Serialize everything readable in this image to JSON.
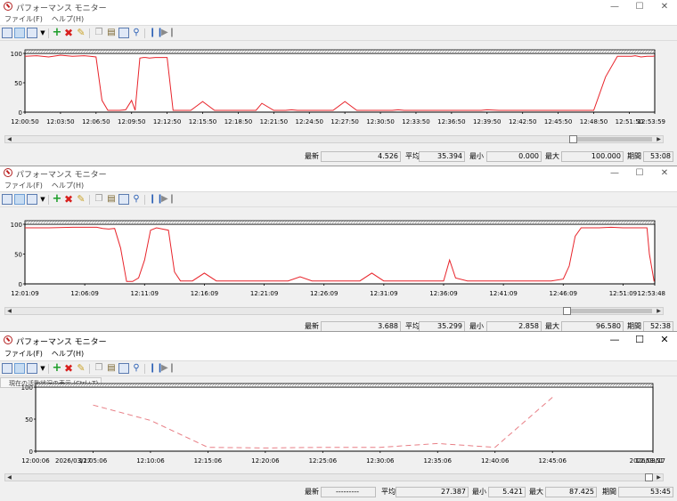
{
  "windows": [
    {
      "title": "パフォーマンス モニター",
      "menu": [
        "ファイル(F)",
        "ヘルプ(H)"
      ],
      "tooltip": "",
      "x_ticks": [
        "12:00:50",
        "12:03:50",
        "12:06:50",
        "12:09:50",
        "12:12:50",
        "12:15:50",
        "12:18:50",
        "12:21:50",
        "12:24:50",
        "12:27:50",
        "12:30:50",
        "12:33:50",
        "12:36:50",
        "12:39:50",
        "12:42:50",
        "12:45:50",
        "12:48:50",
        "12:51:50",
        "12:53:59"
      ],
      "y_ticks": [
        "100",
        "50",
        "0"
      ],
      "stats": {
        "last_label": "最新",
        "last": "4.526",
        "avg_label": "平均",
        "avg": "35.394",
        "min_label": "最小",
        "min": "0.000",
        "max_label": "最大",
        "max": "100.000",
        "dur_label": "期間",
        "dur": "53:08"
      },
      "series_color": "#e8242b",
      "line_style": "solid",
      "scroll_thumb_fraction": 0.88,
      "chart_data": {
        "type": "line",
        "x_start": "12:00:50",
        "x_end": "12:53:59",
        "ylim": [
          0,
          100
        ],
        "x_minutes": [
          0,
          1,
          2,
          3,
          4,
          5,
          5.5,
          6,
          6.5,
          7,
          8,
          8.5,
          9,
          9.3,
          9.7,
          10,
          10.2,
          10.5,
          11,
          12,
          12.5,
          13,
          14,
          15,
          16,
          17,
          18,
          18.5,
          19,
          19.5,
          20,
          21,
          22,
          22.5,
          23,
          23.5,
          24,
          25,
          26,
          27,
          28,
          29,
          30,
          31,
          31.5,
          32,
          32.5,
          33,
          33.3,
          33.7,
          34,
          34.5,
          35,
          36,
          37,
          38,
          38.5,
          39,
          40,
          41,
          42,
          42.5,
          43,
          43.5,
          44,
          45,
          46,
          47,
          48,
          49,
          50,
          51,
          51.2,
          51.5,
          52,
          52.5,
          53,
          53.15
        ],
        "values": [
          95,
          96,
          94,
          97,
          95,
          96,
          95,
          94,
          20,
          3,
          3,
          4,
          20,
          3,
          92,
          93,
          93,
          92,
          93,
          93,
          3,
          3,
          3,
          18,
          3,
          3,
          3,
          3,
          3,
          3,
          15,
          3,
          3,
          4,
          3,
          3,
          3,
          3,
          3,
          18,
          3,
          3,
          3,
          3,
          4,
          3,
          3,
          3,
          3,
          3,
          3,
          3,
          3,
          3,
          3,
          3,
          3,
          4,
          3,
          3,
          3,
          3,
          3,
          3,
          3,
          3,
          3,
          3,
          3,
          60,
          95,
          95,
          95,
          96,
          94,
          95,
          95,
          96,
          97
        ]
      }
    },
    {
      "title": "パフォーマンス モニター",
      "menu": [
        "ファイル(F)",
        "ヘルプ(H)"
      ],
      "tooltip": "",
      "x_ticks": [
        "12:01:09",
        "12:06:09",
        "12:11:09",
        "12:16:09",
        "12:21:09",
        "12:26:09",
        "12:31:09",
        "12:36:09",
        "12:41:09",
        "12:46:09",
        "12:51:09",
        "12:53:48"
      ],
      "y_ticks": [
        "100",
        "50",
        "0"
      ],
      "stats": {
        "last_label": "最新",
        "last": "3.688",
        "avg_label": "平均",
        "avg": "35.299",
        "min_label": "最小",
        "min": "2.858",
        "max_label": "最大",
        "max": "96.580",
        "dur_label": "期間",
        "dur": "52:38"
      },
      "series_color": "#e8242b",
      "line_style": "solid",
      "scroll_thumb_fraction": 0.87,
      "chart_data": {
        "type": "line",
        "x_start": "12:01:09",
        "x_end": "12:53:48",
        "ylim": [
          0,
          100
        ],
        "x_minutes": [
          0,
          2,
          4,
          6,
          6.5,
          7,
          7.5,
          8,
          8.5,
          9,
          9.5,
          10,
          10.5,
          11,
          11.5,
          12,
          12.5,
          13,
          13.5,
          14,
          15,
          16,
          17,
          18,
          19,
          20,
          21,
          22,
          23,
          24,
          25,
          26,
          27,
          28,
          29,
          30,
          31,
          32,
          33,
          34,
          34.5,
          35,
          35.5,
          36,
          37,
          38,
          39,
          40,
          41,
          42,
          43,
          44,
          45,
          45.5,
          46,
          46.5,
          47,
          48,
          49,
          50,
          51,
          52,
          52.2,
          52.6
        ],
        "values": [
          94,
          94,
          95,
          95,
          93,
          92,
          93,
          60,
          4,
          4,
          10,
          40,
          90,
          94,
          92,
          90,
          20,
          5,
          5,
          5,
          18,
          5,
          5,
          5,
          5,
          5,
          5,
          5,
          12,
          5,
          5,
          5,
          5,
          5,
          18,
          5,
          5,
          5,
          5,
          5,
          5,
          5,
          40,
          10,
          5,
          5,
          5,
          5,
          5,
          5,
          5,
          5,
          8,
          30,
          80,
          94,
          94,
          94,
          95,
          94,
          94,
          94,
          50,
          4
        ]
      }
    },
    {
      "title": "パフォーマンス モニター",
      "menu": [
        "ファイル(F)",
        "ヘルプ(H)"
      ],
      "tooltip": "現在の活動状況の表示 (Ctrl+T)",
      "x_ticks": [
        "12:00:06",
        "2026/03/17",
        "12:05:06",
        "12:10:06",
        "12:15:06",
        "12:20:06",
        "12:25:06",
        "12:30:06",
        "12:35:06",
        "12:40:06",
        "12:45:06",
        "12:53:51",
        "2026/03/17"
      ],
      "y_ticks": [
        "100",
        "50",
        "0"
      ],
      "stats": {
        "last_label": "最新",
        "last": "---------",
        "avg_label": "平均",
        "avg": "27.387",
        "min_label": "最小",
        "min": "5.421",
        "max_label": "最大",
        "max": "87.425",
        "dur_label": "期間",
        "dur": "53:45"
      },
      "series_color": "#e87f86",
      "line_style": "dashed",
      "scroll_thumb_fraction": 1.0,
      "chart_data": {
        "type": "line",
        "x_start": "12:00:06",
        "x_end": "12:53:51",
        "ylim": [
          0,
          100
        ],
        "x_minutes": [
          5,
          10,
          15,
          20,
          25,
          30,
          35,
          40,
          45
        ],
        "values": [
          72,
          48,
          6,
          5,
          6,
          6,
          12,
          6,
          84
        ]
      }
    }
  ]
}
